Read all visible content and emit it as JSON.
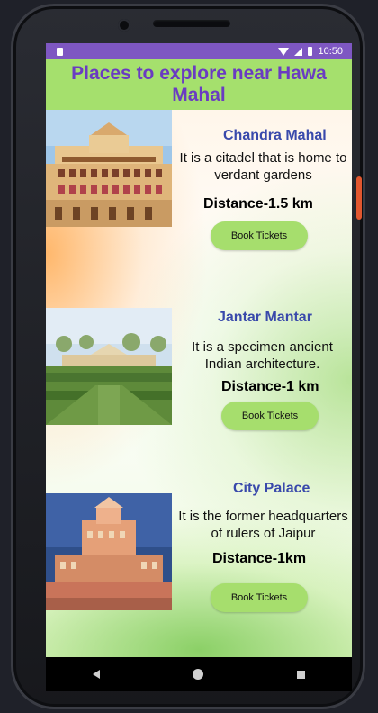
{
  "status_bar": {
    "time": "10:50"
  },
  "header": {
    "title": "Places to explore near Hawa Mahal"
  },
  "places": [
    {
      "name": "Chandra Mahal",
      "description": "It is a citadel that is home to verdant gardens",
      "distance": "Distance-1.5 km",
      "button_label": "Book Tickets"
    },
    {
      "name": "Jantar Mantar",
      "description": "It is a specimen ancient Indian architecture.",
      "distance": "Distance-1 km",
      "button_label": "Book Tickets"
    },
    {
      "name": "City Palace",
      "description": "It is the former headquarters of rulers of Jaipur",
      "distance": "Distance-1km",
      "button_label": "Book Tickets"
    }
  ],
  "colors": {
    "status_bar": "#7e57c2",
    "header_bg": "#a5e06d",
    "title": "#6a3bc2",
    "place_name": "#3949ab",
    "button": "#a6de6d"
  }
}
